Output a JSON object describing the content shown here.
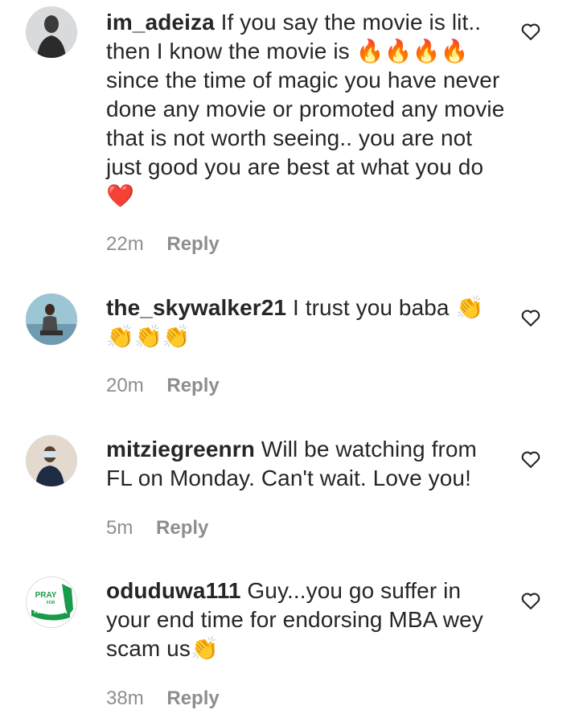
{
  "comments": [
    {
      "username": "im_adeiza",
      "text": "If you say the movie is lit.. then I know the movie is 🔥🔥🔥🔥 since the time of magic you have never done any movie or promoted any movie that is not worth seeing.. you are not just good you are best at what you do ❤️",
      "time": "22m",
      "reply_label": "Reply"
    },
    {
      "username": "the_skywalker21",
      "text": "I trust you baba 👏 👏👏👏",
      "time": "20m",
      "reply_label": "Reply"
    },
    {
      "username": "mitziegreenrn",
      "text": "Will be watching from FL on Monday. Can't wait. Love you!",
      "time": "5m",
      "reply_label": "Reply"
    },
    {
      "username": "oduduwa111",
      "text": "Guy...you go suffer in your end time for endorsing MBA wey scam us👏",
      "time": "38m",
      "reply_label": "Reply"
    }
  ],
  "avatar4": {
    "line1": "PRAY",
    "line2": "FOR",
    "line3": "NIGERIA"
  },
  "icons": {
    "like": "heart-outline-icon"
  },
  "colors": {
    "text": "#262626",
    "meta": "#8e8e8e",
    "nigeria_green": "#1a9b4b"
  }
}
